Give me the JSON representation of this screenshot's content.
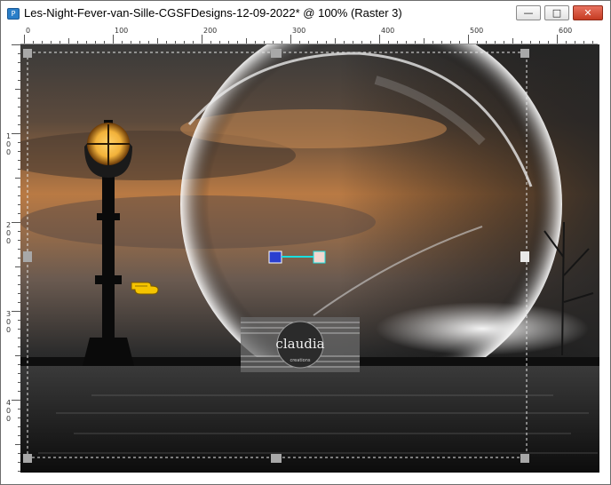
{
  "window": {
    "title": "Les-Night-Fever-van-Sille-CGSFDesigns-12-09-2022* @ 100% (Raster 3)",
    "app_icon_glyph": "P",
    "buttons": {
      "minimize_glyph": "—",
      "maximize_glyph": "□",
      "close_glyph": "✕"
    }
  },
  "rulers": {
    "horizontal_labels": [
      "0",
      "100",
      "200",
      "300",
      "400",
      "500",
      "600"
    ],
    "vertical_labels": [
      [
        "1",
        "0",
        "0"
      ],
      [
        "2",
        "0",
        "0"
      ],
      [
        "3",
        "0",
        "0"
      ],
      [
        "4",
        "0",
        "0"
      ]
    ]
  },
  "watermark": {
    "text": "claudia",
    "subtext": "creations"
  },
  "colors": {
    "sky_warm": "#b97a44",
    "lamp_glow": "#f2b23a",
    "pointer": "#f5c400",
    "handle": "#a8a8a8"
  },
  "icons": {
    "pointer": "pointing-hand-icon",
    "app": "paintshop-app-icon"
  }
}
